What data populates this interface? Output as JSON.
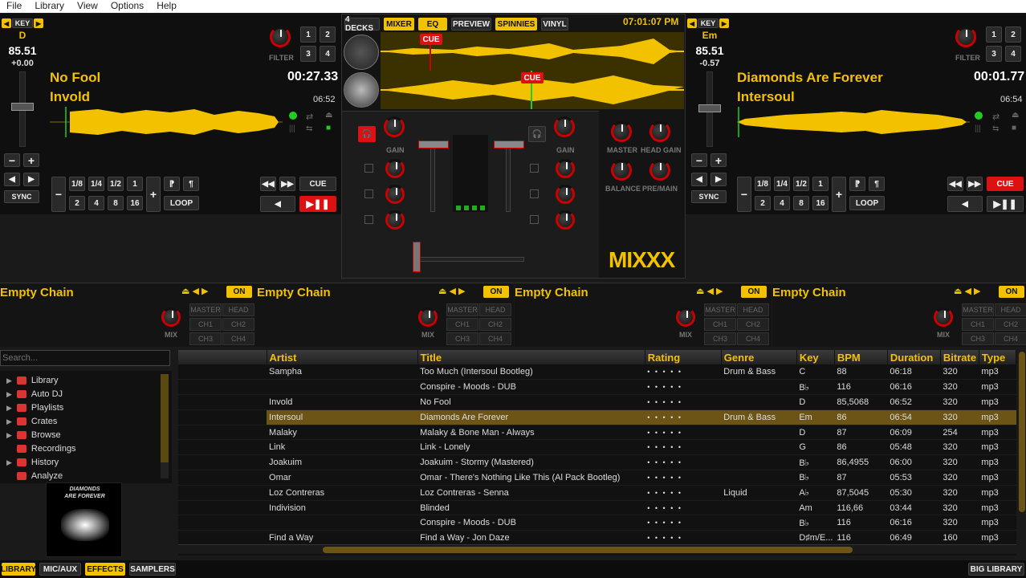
{
  "menu": [
    "File",
    "Library",
    "View",
    "Options",
    "Help"
  ],
  "deck_left": {
    "key_label": "KEY",
    "key": "D",
    "bpm": "85.51",
    "pitch": "+0.00",
    "title": "No Fool",
    "artist": "Invold",
    "time": "00:27.33",
    "duration": "06:52",
    "filter_label": "FILTER",
    "loop_label": "LOOP",
    "cue_label": "CUE",
    "sync_label": "SYNC",
    "hotcues": [
      "1",
      "2",
      "3",
      "4"
    ],
    "beatloops": [
      "1/8",
      "1/4",
      "1/2",
      "1",
      "2",
      "4",
      "8",
      "16"
    ]
  },
  "deck_right": {
    "key_label": "KEY",
    "key": "Em",
    "bpm": "85.51",
    "pitch": "-0.57",
    "title": "Diamonds Are Forever",
    "artist": "Intersoul",
    "time": "00:01.77",
    "duration": "06:54",
    "filter_label": "FILTER",
    "loop_label": "LOOP",
    "cue_label": "CUE",
    "sync_label": "SYNC",
    "hotcues": [
      "1",
      "2",
      "3",
      "4"
    ],
    "beatloops": [
      "1/8",
      "1/4",
      "1/2",
      "1",
      "2",
      "4",
      "8",
      "16"
    ]
  },
  "mixer": {
    "tabs": [
      "4 DECKS",
      "MIXER",
      "EQ",
      "PREVIEW",
      "SPINNIES",
      "VINYL"
    ],
    "active_tabs": [
      "MIXER",
      "EQ",
      "SPINNIES"
    ],
    "clock": "07:01:07 PM",
    "cue_marker": "CUE",
    "gain": "GAIN",
    "master": "MASTER",
    "head_gain": "HEAD GAIN",
    "balance": "BALANCE",
    "pre_main": "PRE/MAIN",
    "logo": "MIXXX"
  },
  "effects": [
    {
      "name": "Empty Chain",
      "on": "ON",
      "mix": "MIX",
      "routes": [
        "MASTER",
        "HEAD",
        "CH1",
        "CH2",
        "CH3",
        "CH4"
      ]
    },
    {
      "name": "Empty Chain",
      "on": "ON",
      "mix": "MIX",
      "routes": [
        "MASTER",
        "HEAD",
        "CH1",
        "CH2",
        "CH3",
        "CH4"
      ]
    },
    {
      "name": "Empty Chain",
      "on": "ON",
      "mix": "MIX",
      "routes": [
        "MASTER",
        "HEAD",
        "CH1",
        "CH2",
        "CH3",
        "CH4"
      ]
    },
    {
      "name": "Empty Chain",
      "on": "ON",
      "mix": "MIX",
      "routes": [
        "MASTER",
        "HEAD",
        "CH1",
        "CH2",
        "CH3",
        "CH4"
      ]
    }
  ],
  "search": {
    "placeholder": "Search..."
  },
  "sidebar": [
    "Library",
    "Auto DJ",
    "Playlists",
    "Crates",
    "Browse",
    "Recordings",
    "History",
    "Analyze"
  ],
  "cover": {
    "line1": "DIAMONDS",
    "line2": "ARE FOREVER"
  },
  "library": {
    "columns": [
      "",
      "Artist",
      "Title",
      "Rating",
      "Genre",
      "Key",
      "BPM",
      "Duration",
      "Bitrate",
      "Type"
    ],
    "rows": [
      [
        "",
        "Sampha",
        "Too Much (Intersoul Bootleg)",
        "• • • • •",
        "Drum & Bass",
        "C",
        "88",
        "06:18",
        "320",
        "mp3"
      ],
      [
        "",
        "",
        "Conspire - Moods - DUB",
        "• • • • •",
        "",
        "B♭",
        "116",
        "06:16",
        "320",
        "mp3"
      ],
      [
        "",
        "Invold",
        "No Fool",
        "• • • • •",
        "",
        "D",
        "85,5068",
        "06:52",
        "320",
        "mp3"
      ],
      [
        "",
        "Intersoul",
        "Diamonds Are Forever",
        "• • • • •",
        "Drum & Bass",
        "Em",
        "86",
        "06:54",
        "320",
        "mp3"
      ],
      [
        "",
        "Malaky",
        "Malaky & Bone Man - Always",
        "• • • • •",
        "",
        "D",
        "87",
        "06:09",
        "254",
        "mp3"
      ],
      [
        "",
        "Link",
        "Link - Lonely",
        "• • • • •",
        "",
        "G",
        "86",
        "05:48",
        "320",
        "mp3"
      ],
      [
        "",
        "Joakuim",
        "Joakuim - Stormy (Mastered)",
        "• • • • •",
        "",
        "B♭",
        "86,4955",
        "06:00",
        "320",
        "mp3"
      ],
      [
        "",
        "Omar",
        "Omar - There's Nothing Like This (Al Pack Bootleg)",
        "• • • • •",
        "",
        "B♭",
        "87",
        "05:53",
        "320",
        "mp3"
      ],
      [
        "",
        "Loz Contreras",
        "Loz Contreras - Senna",
        "• • • • •",
        "Liquid",
        "A♭",
        "87,5045",
        "05:30",
        "320",
        "mp3"
      ],
      [
        "",
        "Indivision",
        "Blinded",
        "• • • • •",
        "",
        "Am",
        "116,66",
        "03:44",
        "320",
        "mp3"
      ],
      [
        "",
        "",
        "Conspire - Moods - DUB",
        "• • • • •",
        "",
        "B♭",
        "116",
        "06:16",
        "320",
        "mp3"
      ],
      [
        "",
        "Find a Way",
        "Find a Way - Jon Daze",
        "• • • • •",
        "",
        "D♯m/E...",
        "116",
        "06:49",
        "160",
        "mp3"
      ]
    ],
    "selected": 3
  },
  "bottom": {
    "left": [
      "LIBRARY",
      "MIC/AUX",
      "EFFECTS",
      "SAMPLERS"
    ],
    "active": [
      "LIBRARY",
      "EFFECTS"
    ],
    "right": "BIG LIBRARY"
  },
  "colors": {
    "accent": "#f2c200",
    "red": "#d11111",
    "bg": "#111111"
  }
}
